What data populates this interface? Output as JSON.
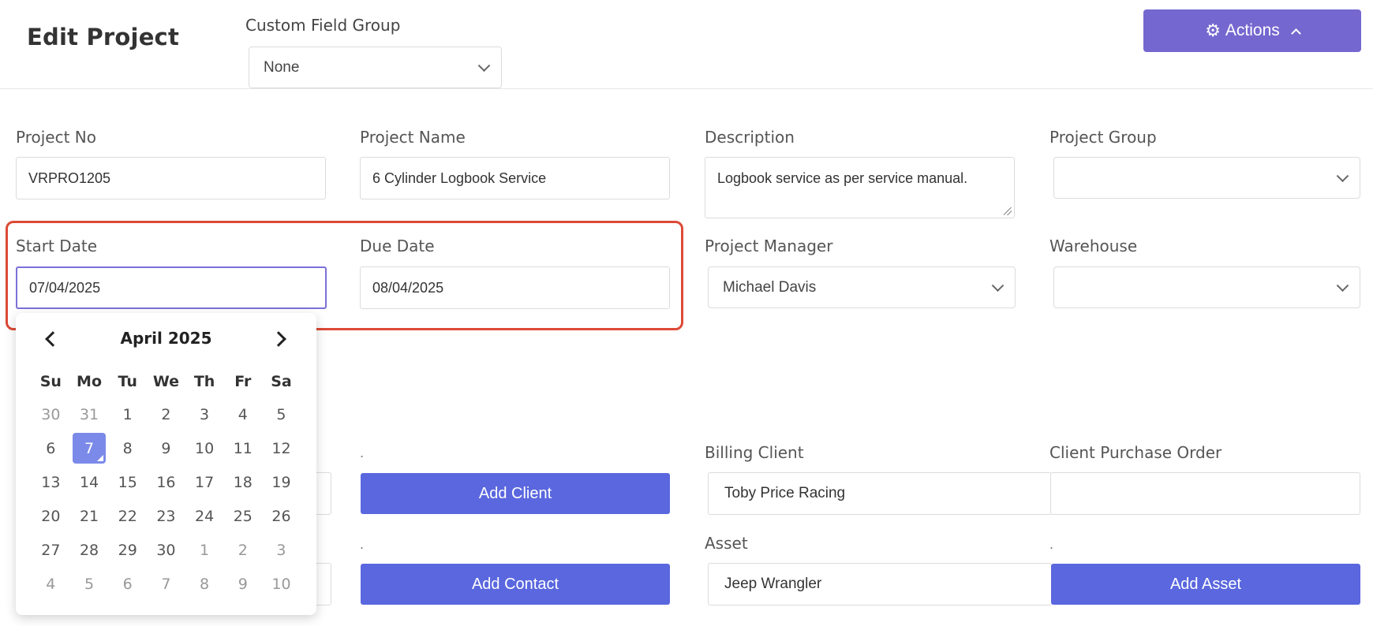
{
  "header": {
    "title": "Edit Project",
    "custom_field_group": {
      "label": "Custom Field Group",
      "value": "None"
    },
    "actions": {
      "label": "Actions",
      "icon": "gear-icon"
    }
  },
  "form": {
    "project_no": {
      "label": "Project No",
      "value": "VRPRO1205"
    },
    "project_name": {
      "label": "Project Name",
      "value": "6 Cylinder Logbook Service"
    },
    "description": {
      "label": "Description",
      "value": "Logbook service as per service manual."
    },
    "project_group": {
      "label": "Project Group",
      "value": ""
    },
    "start_date": {
      "label": "Start Date",
      "value": "07/04/2025"
    },
    "due_date": {
      "label": "Due Date",
      "value": "08/04/2025"
    },
    "project_manager": {
      "label": "Project Manager",
      "value": "Michael Davis"
    },
    "warehouse": {
      "label": "Warehouse",
      "value": ""
    },
    "billing_client": {
      "label": "Billing Client",
      "value": "Toby Price Racing"
    },
    "client_purchase_order": {
      "label": "Client Purchase Order",
      "value": ""
    },
    "asset": {
      "label": "Asset",
      "value": "Jeep Wrangler"
    },
    "add_client": {
      "label": "Add Client",
      "dot": "."
    },
    "add_contact": {
      "label": "Add Contact",
      "dot": "."
    },
    "add_asset": {
      "label": "Add Asset",
      "dot": "."
    }
  },
  "calendar": {
    "title": "April 2025",
    "weekdays": [
      "Su",
      "Mo",
      "Tu",
      "We",
      "Th",
      "Fr",
      "Sa"
    ],
    "weeks": [
      [
        "30",
        "31",
        "1",
        "2",
        "3",
        "4",
        "5"
      ],
      [
        "6",
        "7",
        "8",
        "9",
        "10",
        "11",
        "12"
      ],
      [
        "13",
        "14",
        "15",
        "16",
        "17",
        "18",
        "19"
      ],
      [
        "20",
        "21",
        "22",
        "23",
        "24",
        "25",
        "26"
      ],
      [
        "27",
        "28",
        "29",
        "30",
        "1",
        "2",
        "3"
      ],
      [
        "4",
        "5",
        "6",
        "7",
        "8",
        "9",
        "10"
      ]
    ],
    "selected": "7"
  },
  "colors": {
    "accent": "#5a67de",
    "actions_bg": "#7468d0",
    "highlight_border": "#dc4a36",
    "selected_day": "#7b8ae8"
  }
}
